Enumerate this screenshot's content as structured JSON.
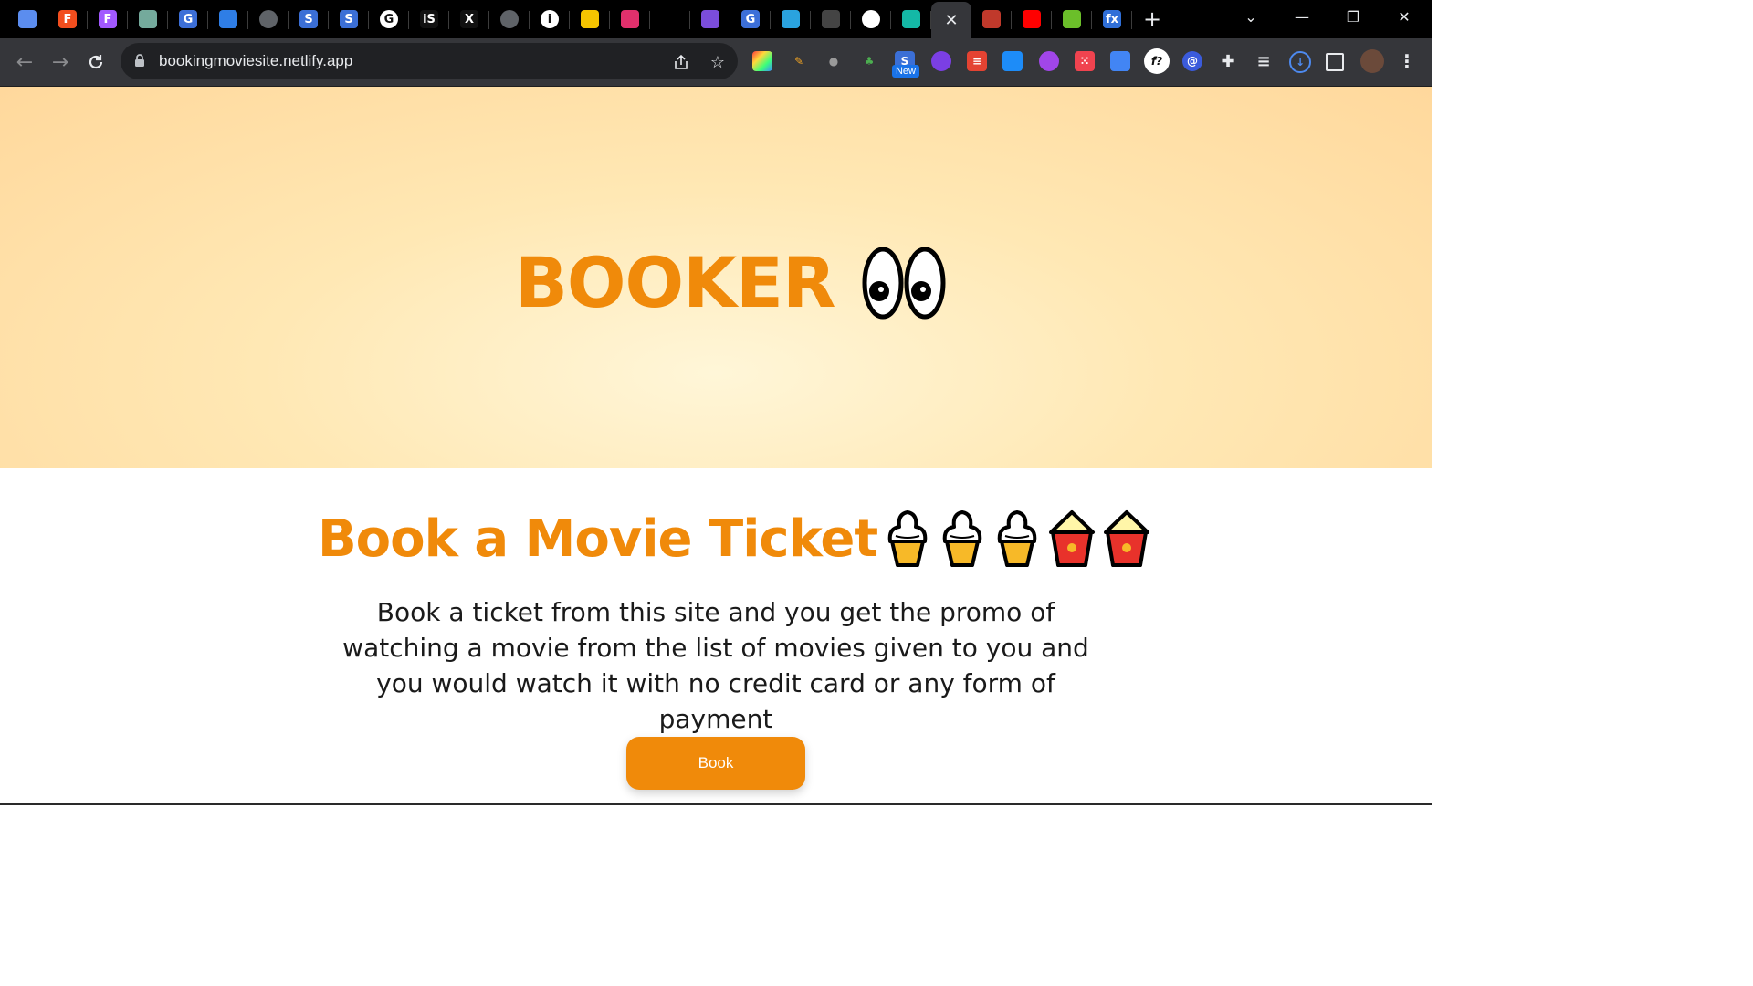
{
  "browser": {
    "tabs": [
      {
        "icon": "gear-hex-icon",
        "letter": "",
        "color": "#5b8def"
      },
      {
        "icon": "figma-icon",
        "letter": "F",
        "color": "#f24e1e"
      },
      {
        "icon": "figma-icon",
        "letter": "F",
        "color": "#a259ff"
      },
      {
        "icon": "chatgpt-icon",
        "letter": "",
        "color": "#74aa9c"
      },
      {
        "icon": "g-circle-icon",
        "letter": "G",
        "color": "#3c6fd8"
      },
      {
        "icon": "trello-icon",
        "letter": "",
        "color": "#2f7ee6"
      },
      {
        "icon": "globe-icon",
        "letter": "",
        "color": "#5f6368"
      },
      {
        "icon": "s-logo-icon",
        "letter": "S",
        "color": "#3b6fd6"
      },
      {
        "icon": "s-logo-icon",
        "letter": "S",
        "color": "#3b6fd6"
      },
      {
        "icon": "google-icon",
        "letter": "G",
        "color": "#ffffff"
      },
      {
        "icon": "is-icon",
        "letter": "iS",
        "color": "#111111"
      },
      {
        "icon": "x-icon",
        "letter": "X",
        "color": "#111111"
      },
      {
        "icon": "globe-icon",
        "letter": "",
        "color": "#5f6368"
      },
      {
        "icon": "info-icon",
        "letter": "i",
        "color": "#ffffff"
      },
      {
        "icon": "butterfly-icon",
        "letter": "",
        "color": "#f5c400"
      },
      {
        "icon": "instagram-icon",
        "letter": "",
        "color": "#e1306c"
      },
      {
        "icon": "blank-icon",
        "letter": "",
        "color": "#000000"
      },
      {
        "icon": "people-icon",
        "letter": "",
        "color": "#7b4ddb"
      },
      {
        "icon": "g-circle-icon",
        "letter": "G",
        "color": "#3c6fd8"
      },
      {
        "icon": "telegram-icon",
        "letter": "",
        "color": "#2aa3df"
      },
      {
        "icon": "github-icon",
        "letter": "",
        "color": "#444444"
      },
      {
        "icon": "chrome-icon",
        "letter": "",
        "color": "#ffffff"
      },
      {
        "icon": "diamond-icon",
        "letter": "",
        "color": "#14b8a6"
      }
    ],
    "active_tab_close": "✕",
    "tabs_after": [
      {
        "icon": "flag-icon",
        "letter": "",
        "color": "#c0392b"
      },
      {
        "icon": "youtube-icon",
        "letter": "",
        "color": "#ff0000"
      },
      {
        "icon": "download-arrow-icon",
        "letter": "",
        "color": "#6bbf2a"
      },
      {
        "icon": "fx-icon",
        "letter": "fx",
        "color": "#2f6fd8"
      }
    ],
    "new_tab": "+",
    "url": "bookingmoviesite.netlify.app",
    "new_badge": "New"
  },
  "hero": {
    "brand": "BOOKER"
  },
  "main": {
    "title": "Book a Movie Ticket",
    "description": "Book a ticket from this site and you get the promo of watching a movie from the list of movies given to you and you would watch it with no credit card or any form of payment",
    "button": "Book"
  },
  "colors": {
    "accent": "#f08a0a",
    "hero_bg": "#ffe8b4",
    "chrome_bg": "#35363a",
    "tab_bg": "#000000"
  }
}
